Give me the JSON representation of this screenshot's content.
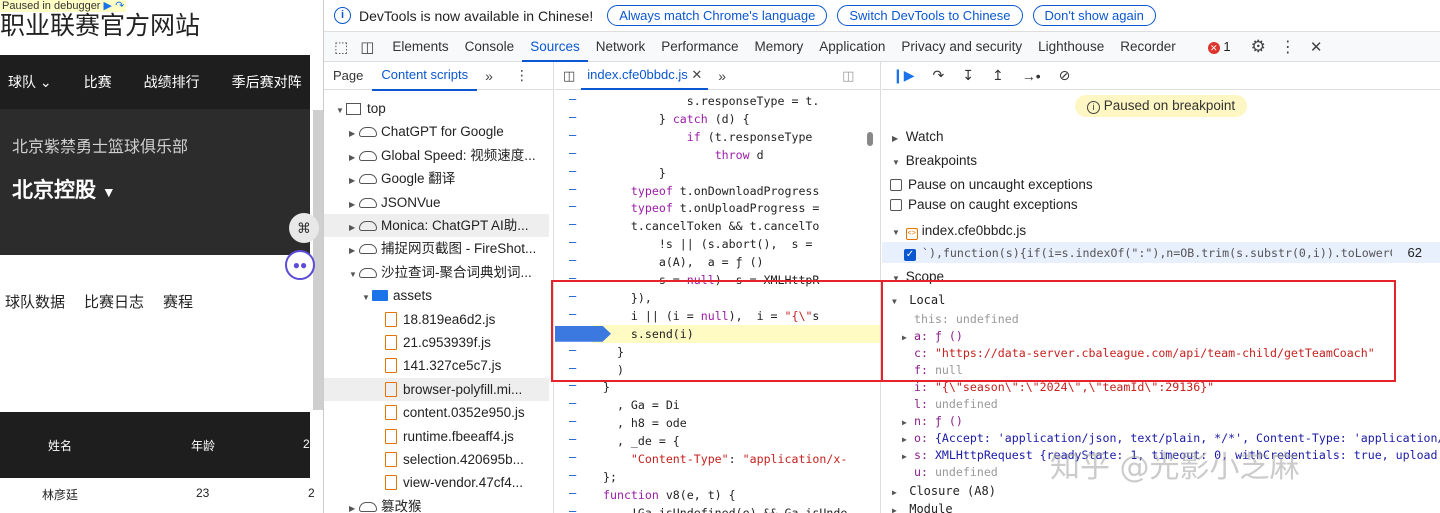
{
  "site": {
    "paused_label": "Paused in debugger",
    "title": "职业联赛官方网站",
    "nav": [
      "球队 ⌄",
      "比赛",
      "战绩排行",
      "季后赛对阵"
    ],
    "club_name": "北京紫禁勇士篮球俱乐部",
    "team_name": "北京控股",
    "tabs": [
      "球队数据",
      "比赛日志",
      "赛程"
    ],
    "table_headers": [
      "姓名",
      "年龄",
      "2"
    ],
    "row": {
      "name": "林彦廷",
      "age": "23",
      "extra": "2"
    }
  },
  "devtools": {
    "notice": {
      "text": "DevTools is now available in Chinese!",
      "buttons": [
        "Always match Chrome's language",
        "Switch DevTools to Chinese",
        "Don't show again"
      ]
    },
    "tabs": [
      "Elements",
      "Console",
      "Sources",
      "Network",
      "Performance",
      "Memory",
      "Application",
      "Privacy and security",
      "Lighthouse",
      "Recorder"
    ],
    "active_tab": "Sources",
    "error_count": "1",
    "navigator": {
      "tabs": [
        "Page",
        "Content scripts"
      ],
      "items": [
        {
          "label": "top",
          "kind": "frame",
          "depth": 0,
          "open": true
        },
        {
          "label": "ChatGPT for Google",
          "kind": "cloud",
          "depth": 1
        },
        {
          "label": "Global Speed: 视频速度...",
          "kind": "cloud",
          "depth": 1
        },
        {
          "label": "Google 翻译",
          "kind": "cloud",
          "depth": 1
        },
        {
          "label": "JSONVue",
          "kind": "cloud",
          "depth": 1
        },
        {
          "label": "Monica: ChatGPT AI助...",
          "kind": "cloud",
          "depth": 1,
          "hover": true
        },
        {
          "label": "捕捉网页截图 - FireShot...",
          "kind": "cloud",
          "depth": 1
        },
        {
          "label": "沙拉查词-聚合词典划词...",
          "kind": "cloud",
          "depth": 1,
          "open": true
        },
        {
          "label": "assets",
          "kind": "folder",
          "depth": 2,
          "open": true
        },
        {
          "label": "18.819ea6d2.js",
          "kind": "file",
          "depth": 3
        },
        {
          "label": "21.c953939f.js",
          "kind": "file",
          "depth": 3
        },
        {
          "label": "141.327ce5c7.js",
          "kind": "file",
          "depth": 3
        },
        {
          "label": "browser-polyfill.mi...",
          "kind": "file",
          "depth": 3,
          "selected": true
        },
        {
          "label": "content.0352e950.js",
          "kind": "file",
          "depth": 3
        },
        {
          "label": "runtime.fbeeaff4.js",
          "kind": "file",
          "depth": 3
        },
        {
          "label": "selection.420695b...",
          "kind": "file",
          "depth": 3
        },
        {
          "label": "view-vendor.47cf4...",
          "kind": "file",
          "depth": 3
        },
        {
          "label": "篡改猴",
          "kind": "cloud",
          "depth": 1
        }
      ]
    },
    "editor": {
      "file_tab": "index.cfe0bbdc.js",
      "lines": [
        "            s.responseType = t.",
        "        } catch (d) {",
        "            if (t.responseType",
        "                throw d",
        "        }",
        "    typeof t.onDownloadProgress",
        "    typeof t.onUploadProgress =",
        "    t.cancelToken && t.cancelTo",
        "        !s || (s.abort(),  s =",
        "        a(A),  a = ƒ ()",
        "        s = null)  s = XMLHttpR",
        "    }),",
        "    i || (i = null),  i = \"{\\\"s",
        "    s.send(i)",
        "  }",
        "  )",
        "}",
        "  , Ga = Di",
        "  , h8 = ode",
        "  , _de = {",
        "    \"Content-Type\": \"application/x-",
        "};",
        "function v8(e, t) {",
        "    !Ga.isUndefined(e) && Ga.isUnde"
      ],
      "current_line": 13
    },
    "debugger": {
      "paused_text": "Paused on breakpoint",
      "watch": "Watch",
      "breakpoints": "Breakpoints",
      "pause_uncaught": "Pause on uncaught exceptions",
      "pause_caught": "Pause on caught exceptions",
      "bp_file": "index.cfe0bbdc.js",
      "bp_code": "`),function(s){if(i=s.indexOf(\":\"),n=OB.trim(s.substr(0,i)).toLowerC…",
      "bp_line": "62",
      "scope": "Scope",
      "local": "Local",
      "vars": [
        {
          "k": "this",
          "v": "undefined",
          "t": "gray"
        },
        {
          "k": "a",
          "v": "ƒ ()",
          "t": "fn",
          "arrow": true
        },
        {
          "k": "c",
          "v": "\"https://data-server.cbaleague.com/api/team-child/getTeamCoach\"",
          "t": "str"
        },
        {
          "k": "f",
          "v": "null",
          "t": "gray"
        },
        {
          "k": "i",
          "v": "\"{\\\"season\\\":\\\"2024\\\",\\\"teamId\\\":29136}\"",
          "t": "str"
        },
        {
          "k": "l",
          "v": "undefined",
          "t": "gray"
        },
        {
          "k": "n",
          "v": "ƒ ()",
          "t": "fn",
          "arrow": true
        },
        {
          "k": "o",
          "v": "{Accept: 'application/json, text/plain, */*', Content-Type: 'application/js",
          "t": "obj",
          "arrow": true
        },
        {
          "k": "s",
          "v": "XMLHttpRequest  {readyState: 1, timeout: 0, withCredentials: true, upload:",
          "t": "obj",
          "arrow": true
        },
        {
          "k": "u",
          "v": "undefined",
          "t": "gray"
        }
      ],
      "closure": "Closure (A8)",
      "module": "Module"
    }
  },
  "watermark": "知乎 @光影小芝麻"
}
